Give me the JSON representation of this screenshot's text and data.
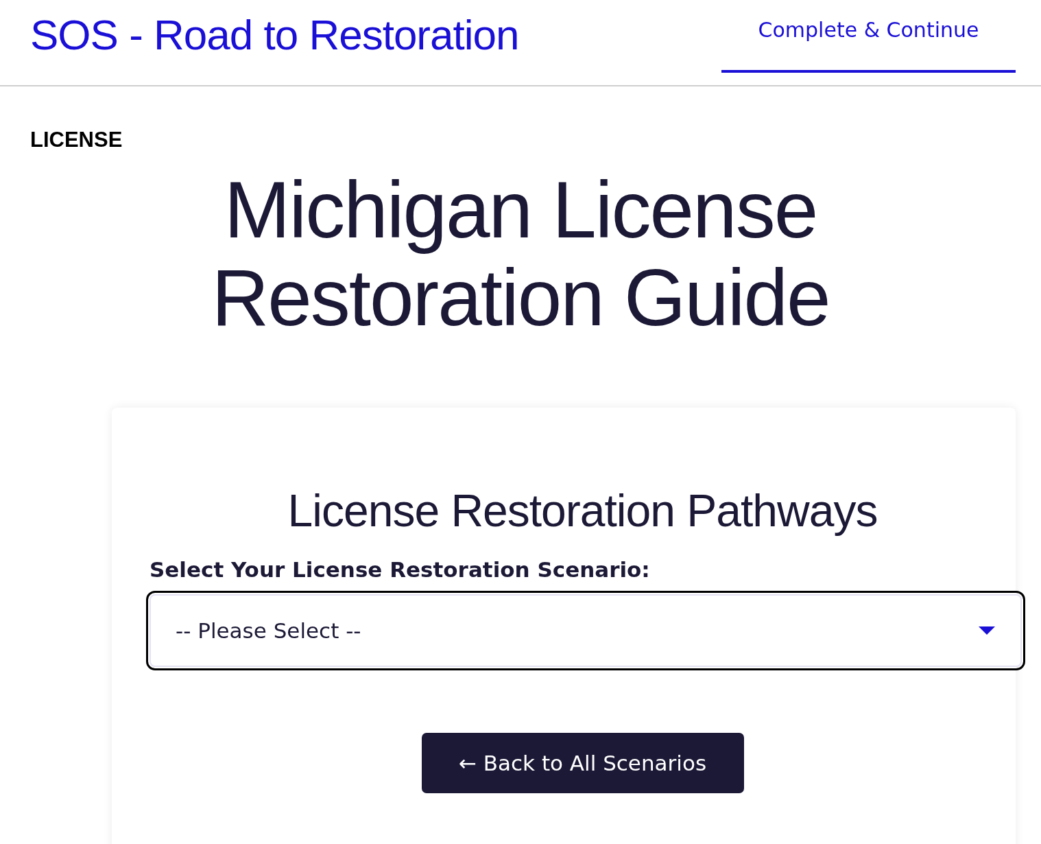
{
  "header": {
    "site_title": "SOS - Road to Restoration",
    "tabs": [
      {
        "label": "Complete & Continue",
        "selected": true
      }
    ]
  },
  "category": "LICENSE",
  "page_title": "Michigan License Restoration Guide",
  "card": {
    "heading": "License Restoration Pathways",
    "field_label": "Select Your License Restoration Scenario:",
    "select": {
      "placeholder": "-- Please Select --",
      "focused": true
    },
    "back_button": "← Back to All Scenarios"
  }
}
